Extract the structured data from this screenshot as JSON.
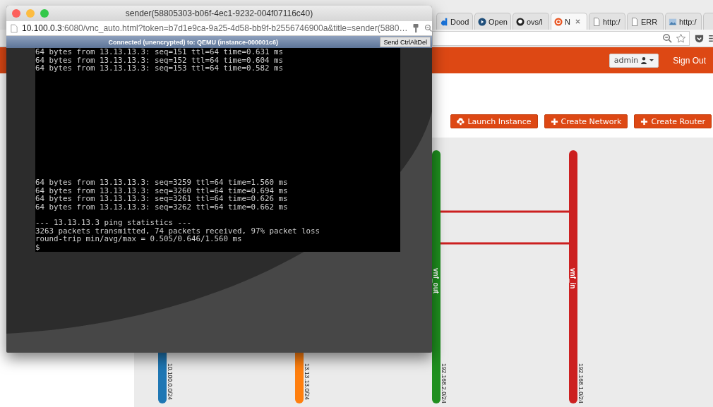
{
  "browser": {
    "tabs": [
      {
        "label": "Dood",
        "kind": "letter",
        "selected": false
      },
      {
        "label": "Open",
        "kind": "play",
        "selected": false
      },
      {
        "label": "ovs/l",
        "kind": "octocat",
        "selected": false
      },
      {
        "label": "N",
        "kind": "ring",
        "selected": true,
        "closable": true
      },
      {
        "label": "http:/",
        "kind": "page",
        "selected": false
      },
      {
        "label": "ERR",
        "kind": "page",
        "selected": false
      },
      {
        "label": "http:/",
        "kind": "image",
        "selected": false
      }
    ]
  },
  "header": {
    "user": "admin",
    "sign_out": "Sign Out"
  },
  "actions": [
    {
      "label": "Launch Instance",
      "kind": "cloud"
    },
    {
      "label": "Create Network",
      "kind": "plus"
    },
    {
      "label": "Create Router",
      "kind": "plus"
    }
  ],
  "topology": {
    "networks": [
      {
        "cidr": "10.100.0.0/24",
        "color": "#1f77b4"
      },
      {
        "cidr": "13.13.13.0/24",
        "color": "#ff7f0e"
      },
      {
        "name": "vnf_out",
        "cidr": "192.168.2.0/24",
        "color": "#1f8f1f"
      },
      {
        "name": "vnf_in",
        "cidr": "192.168.1.0/24",
        "color": "#cc2020"
      }
    ],
    "links": [
      {
        "kind": "router-link"
      },
      {
        "kind": "router-link"
      }
    ]
  },
  "popup": {
    "title": "sender(58805303-b06f-4ec1-9232-004f07116c40)",
    "url": "**10.100.0.3**:6080/vnc_auto.html?token=b7d1e9ca-9a25-4d58-bb9f-b2556746900a&title=sender(5880…",
    "status": "Connected (unencrypted) to: QEMU (instance-000001c6)",
    "button": "Send CtrlAltDel",
    "terminal": [
      [
        "64 bytes from 13.13.13.3: seq=151 ttl=64 time=0.631 ms",
        "64 bytes from 13.13.13.3: seq=152 ttl=64 time=0.604 ms",
        "64 bytes from 13.13.13.3: seq=153 ttl=64 time=0.582 ms"
      ],
      [
        "64 bytes from 13.13.13.3: seq=3259 ttl=64 time=1.560 ms",
        "64 bytes from 13.13.13.3: seq=3260 ttl=64 time=0.694 ms",
        "64 bytes from 13.13.13.3: seq=3261 ttl=64 time=0.626 ms",
        "64 bytes from 13.13.13.3: seq=3262 ttl=64 time=0.662 ms"
      ],
      [
        "--- 13.13.13.3 ping statistics ---",
        "3263 packets transmitted, 74 packets received, 97% packet loss",
        "round-trip min/avg/max = 0.505/0.646/1.560 ms",
        "$"
      ]
    ]
  }
}
